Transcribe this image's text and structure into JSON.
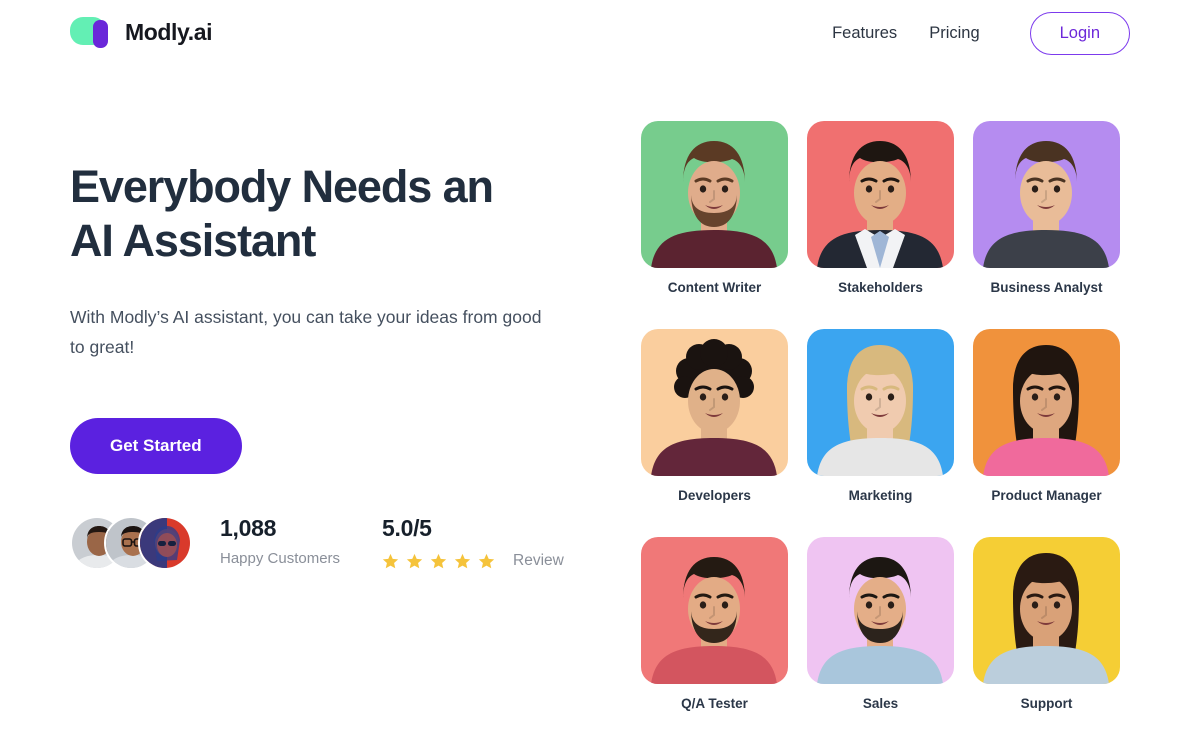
{
  "brand": {
    "name": "Modly.ai",
    "logo_icon": "modly-logo-icon",
    "green": "#63EFB4",
    "purple": "#6A27D9"
  },
  "nav": {
    "links": [
      {
        "label": "Features"
      },
      {
        "label": "Pricing"
      }
    ],
    "login_label": "Login",
    "login_color": "#6D28D9"
  },
  "hero": {
    "headline_line1": "Everybody Needs an",
    "headline_line2": "AI Assistant",
    "subhead": "With Modly’s AI assistant, you can take your ideas from good to great!",
    "cta_label": "Get Started",
    "cta_color": "#5B21E0"
  },
  "proof": {
    "customers_count": "1,088",
    "customers_label": "Happy Customers",
    "rating_value": "5.0/5",
    "rating_stars": 5,
    "star_color": "#F5C33B",
    "review_label": "Review",
    "avatars": [
      {
        "name": "avatar-customer-1",
        "skin": "#9A6647",
        "hair": "#241812",
        "shirt": "#E8EAEC",
        "bg": "#C9CDD2"
      },
      {
        "name": "avatar-customer-2",
        "skin": "#A9714E",
        "hair": "#1B1310",
        "shirt": "#D9DDE2",
        "bg": "#BFC4CA"
      },
      {
        "name": "avatar-customer-3",
        "skin": "#C7553E",
        "hair": "#2B3E8C",
        "shirt": "#1E3A8A",
        "bg": "#D93A2B"
      }
    ]
  },
  "cards": [
    {
      "label": "Content Writer",
      "bg": "#77CC8D",
      "skin": "#E0AC8B",
      "hair": "#5B3A24",
      "shirt": "#5B2330",
      "beard": true,
      "gender": "m",
      "hair_style": "short"
    },
    {
      "label": "Stakeholders",
      "bg": "#F07070",
      "skin": "#E3AE86",
      "hair": "#1E1611",
      "shirt": "#232833",
      "beard": false,
      "gender": "m",
      "hair_style": "short",
      "tie": "#9FB6D6"
    },
    {
      "label": "Business Analyst",
      "bg": "#B58CF0",
      "skin": "#E9BC98",
      "hair": "#4A3322",
      "shirt": "#3C4049",
      "beard": false,
      "gender": "m",
      "hair_style": "short"
    },
    {
      "label": "Developers",
      "bg": "#FACE9E",
      "skin": "#E0B189",
      "hair": "#1A1310",
      "shirt": "#63263A",
      "beard": false,
      "gender": "m",
      "hair_style": "curly"
    },
    {
      "label": "Marketing",
      "bg": "#3BA5F0",
      "skin": "#F0CBAF",
      "hair": "#D8B97E",
      "shirt": "#E6E6E6",
      "beard": false,
      "gender": "f",
      "hair_style": "long"
    },
    {
      "label": "Product Manager",
      "bg": "#F0923C",
      "skin": "#DEA77F",
      "hair": "#20150F",
      "shirt": "#F06A9C",
      "beard": false,
      "gender": "f",
      "hair_style": "long"
    },
    {
      "label": "Q/A Tester",
      "bg": "#F07878",
      "skin": "#E3AB85",
      "hair": "#241A12",
      "shirt": "#D3555F",
      "beard": true,
      "gender": "m",
      "hair_style": "short"
    },
    {
      "label": "Sales",
      "bg": "#EFC4F2",
      "skin": "#E4AE88",
      "hair": "#1C1712",
      "shirt": "#A9C6DC",
      "beard": true,
      "gender": "m",
      "hair_style": "short"
    },
    {
      "label": "Support",
      "bg": "#F5CE35",
      "skin": "#D9A178",
      "hair": "#2A1A12",
      "shirt": "#BBCEDC",
      "beard": false,
      "gender": "f",
      "hair_style": "long"
    }
  ]
}
